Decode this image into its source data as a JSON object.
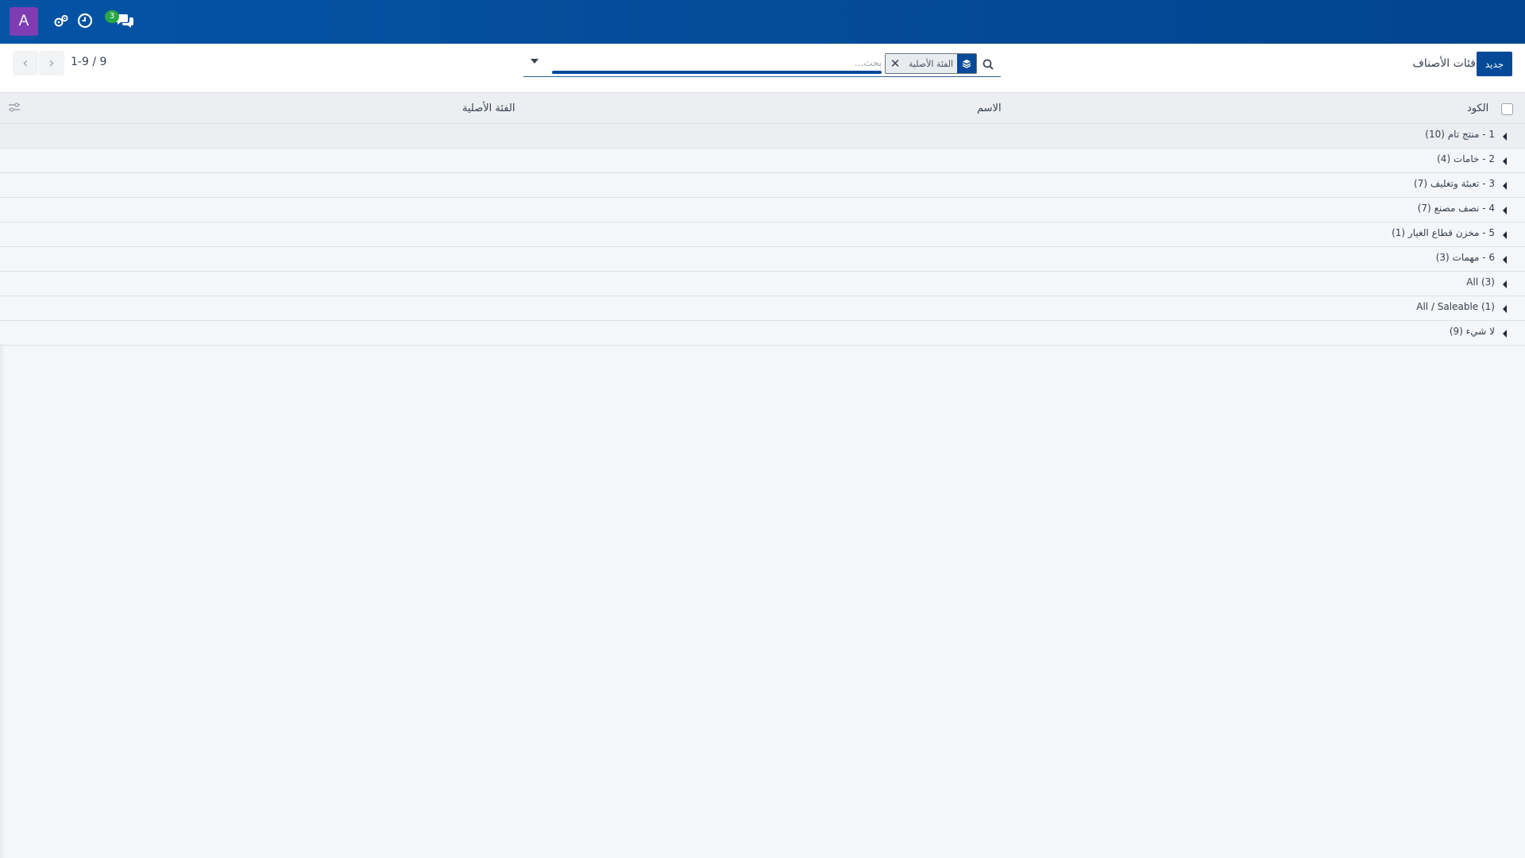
{
  "navbar": {
    "avatar_letter": "A",
    "icons": [
      "activity-gears-icon",
      "clock-icon",
      "chat-icon"
    ],
    "chat_badge": "3",
    "colors": {
      "bar": "#0453a4",
      "avatar": "#7f3db3",
      "badge": "#28a745"
    }
  },
  "control_panel": {
    "breadcrumb": "فئات الأصناف",
    "new_button": "جديد",
    "search": {
      "placeholder": "بحث...",
      "facet_value": "الفئة الأصلية",
      "facet_icon": "layers-icon",
      "facet_close": "✕"
    },
    "pager": {
      "value": "1-9 / 9",
      "prev": "‹",
      "next": "›"
    }
  },
  "list": {
    "columns": {
      "code": "الكود",
      "name": "الاسم",
      "parent": "الفئة الأصلية"
    },
    "groups": [
      {
        "label": "1 - منتج تام (10)"
      },
      {
        "label": "2 - خامات (4)"
      },
      {
        "label": "3 - تعبئة وتغليف (7)"
      },
      {
        "label": "4 - نصف مصنع (7)"
      },
      {
        "label": "5 - مخزن قطاع الغيار (1)"
      },
      {
        "label": "6 - مهمات (3)"
      },
      {
        "label": "All (3)"
      },
      {
        "label": "All / Saleable (1)"
      },
      {
        "label": "لا شيء (9)"
      }
    ]
  },
  "accent_color": "#044a98"
}
